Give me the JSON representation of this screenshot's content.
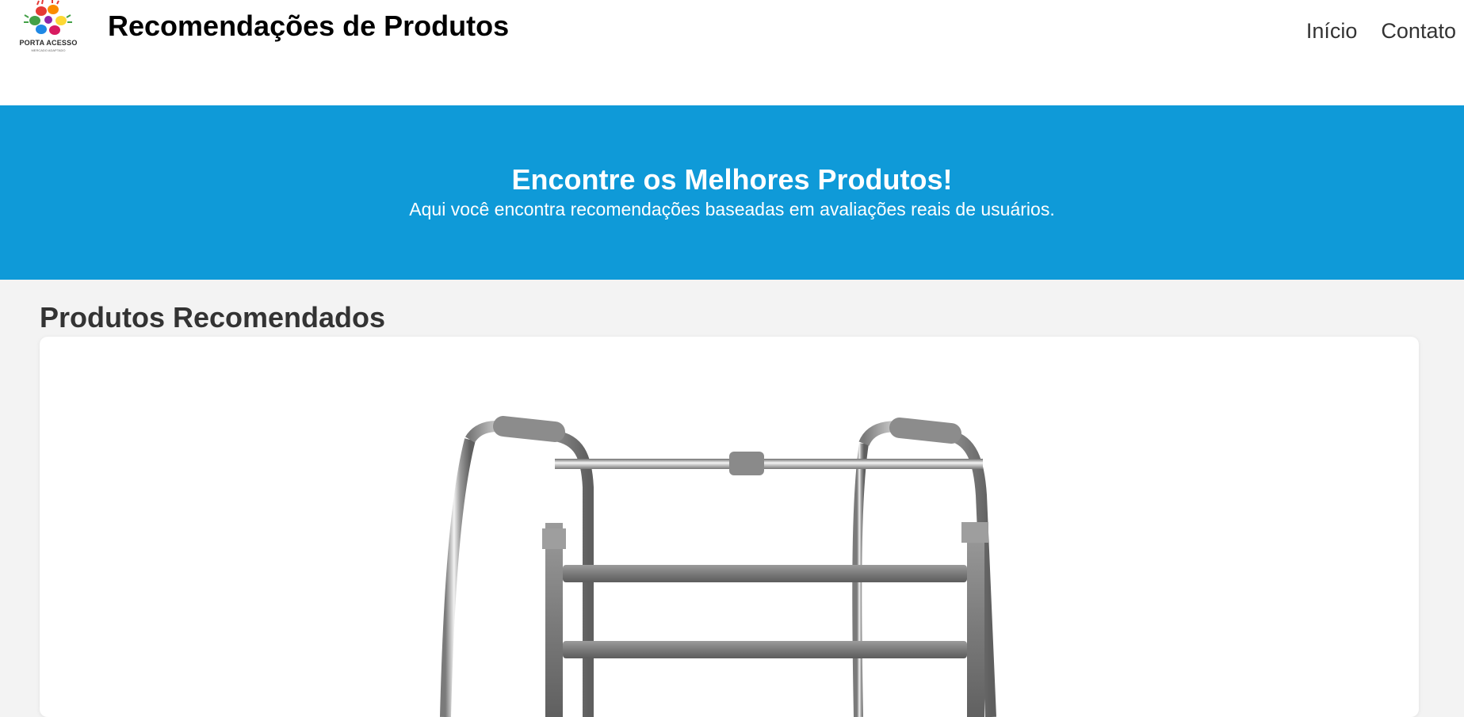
{
  "header": {
    "logo_text": "PORTA ACESSO",
    "logo_subtext": "MERCADO ADAPTADO",
    "title": "Recomendações de Produtos",
    "nav": [
      {
        "label": "Início"
      },
      {
        "label": "Contato"
      }
    ]
  },
  "hero": {
    "heading": "Encontre os Melhores Produtos!",
    "subheading": "Aqui você encontra recomendações baseadas em avaliações reais de usuários."
  },
  "products": {
    "section_title": "Produtos Recomendados",
    "items": [
      {
        "image_icon": "walker-image"
      }
    ]
  },
  "colors": {
    "hero_bg": "#0f9ad8",
    "page_bg": "#f3f3f3"
  }
}
